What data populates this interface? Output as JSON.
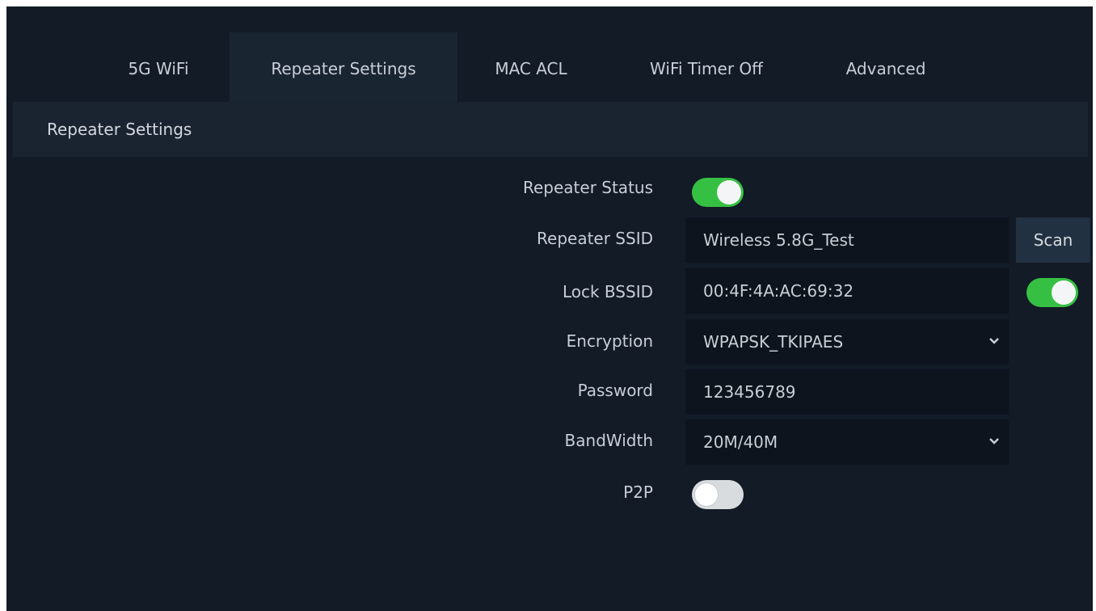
{
  "tabs": [
    {
      "label": "5G WiFi"
    },
    {
      "label": "Repeater Settings",
      "active": true
    },
    {
      "label": "MAC ACL"
    },
    {
      "label": "WiFi Timer Off"
    },
    {
      "label": "Advanced"
    }
  ],
  "section": {
    "title": "Repeater Settings"
  },
  "form": {
    "repeater_status": {
      "label": "Repeater Status",
      "enabled": true
    },
    "repeater_ssid": {
      "label": "Repeater SSID",
      "value": "Wireless 5.8G_Test",
      "scan_label": "Scan"
    },
    "lock_bssid": {
      "label": "Lock BSSID",
      "value": "00:4F:4A:AC:69:32",
      "enabled": true
    },
    "encryption": {
      "label": "Encryption",
      "value": "WPAPSK_TKIPAES"
    },
    "password": {
      "label": "Password",
      "value": "123456789"
    },
    "bandwidth": {
      "label": "BandWidth",
      "value": "20M/40M"
    },
    "p2p": {
      "label": "P2P",
      "enabled": false
    }
  },
  "icons": {
    "select_arrow": "chevron-down-icon"
  },
  "colors": {
    "background": "#121b26",
    "tab_active_bg": "#1a2532",
    "tab_underline": "#a86d34",
    "toggle_on": "#36c043",
    "toggle_off": "#d9dcdf",
    "input_bg": "#0d141d",
    "button_bg": "#223141"
  }
}
